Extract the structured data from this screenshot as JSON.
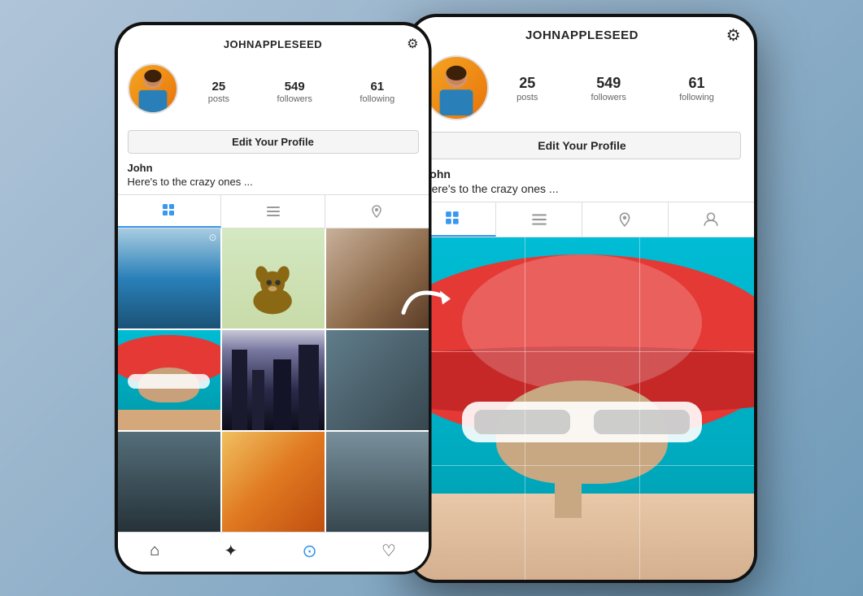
{
  "scene": {
    "arrow": "→",
    "background_color": "#8fafc8"
  },
  "left_phone": {
    "username": "JOHNAPPLESEED",
    "gear_icon": "⚙",
    "stats": {
      "posts": {
        "number": "25",
        "label": "posts"
      },
      "followers": {
        "number": "549",
        "label": "followers"
      },
      "following": {
        "number": "61",
        "label": "following"
      }
    },
    "edit_profile_label": "Edit Your Profile",
    "bio_name": "John",
    "bio_text": "Here's to the crazy ones ...",
    "tabs": [
      "grid",
      "list",
      "location"
    ],
    "bottom_nav": [
      "home",
      "explore",
      "camera",
      "heart"
    ]
  },
  "right_phone": {
    "username": "JOHNAPPLESEED",
    "gear_icon": "⚙",
    "stats": {
      "posts": {
        "number": "25",
        "label": "posts"
      },
      "followers": {
        "number": "549",
        "label": "followers"
      },
      "following": {
        "number": "61",
        "label": "following"
      }
    },
    "edit_profile_label": "Edit Your Profile",
    "bio_name": "John",
    "bio_text": "Here's to the crazy ones ...",
    "tabs": [
      "grid",
      "list",
      "location",
      "person"
    ]
  }
}
